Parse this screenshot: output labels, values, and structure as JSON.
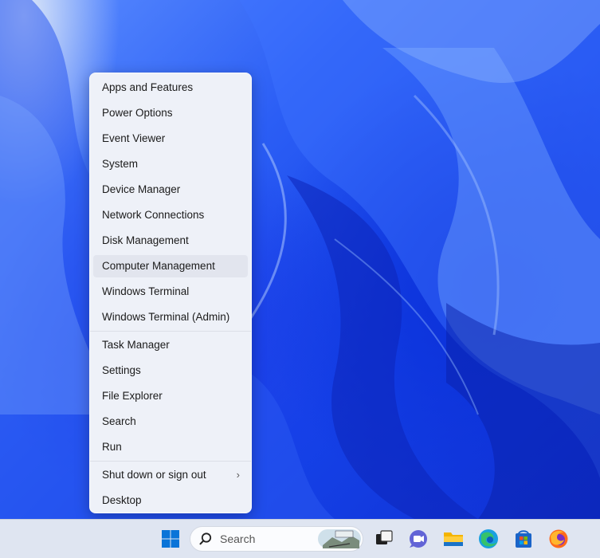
{
  "context_menu": {
    "items": [
      {
        "label": "Apps and Features"
      },
      {
        "label": "Power Options"
      },
      {
        "label": "Event Viewer"
      },
      {
        "label": "System"
      },
      {
        "label": "Device Manager"
      },
      {
        "label": "Network Connections"
      },
      {
        "label": "Disk Management"
      },
      {
        "label": "Computer Management"
      },
      {
        "label": "Windows Terminal"
      },
      {
        "label": "Windows Terminal (Admin)"
      },
      {
        "label": "Task Manager"
      },
      {
        "label": "Settings"
      },
      {
        "label": "File Explorer"
      },
      {
        "label": "Search"
      },
      {
        "label": "Run"
      },
      {
        "label": "Shut down or sign out"
      },
      {
        "label": "Desktop"
      }
    ],
    "hovered_item": "Computer Management",
    "submenu_icon": "chevron-right-icon"
  },
  "taskbar": {
    "search_label": "Search",
    "icons": [
      "windows-start-icon",
      "search-icon",
      "task-view-icon",
      "teams-chat-icon",
      "file-explorer-icon",
      "edge-icon",
      "store-icon",
      "firefox-icon"
    ]
  },
  "colors": {
    "menu_background": "#eef1f8",
    "hover_background": "#e2e5ee",
    "taskbar_background": "#dfe5f1",
    "start_blue": "#0a74d8",
    "wallpaper_blue": "#1542e8"
  }
}
